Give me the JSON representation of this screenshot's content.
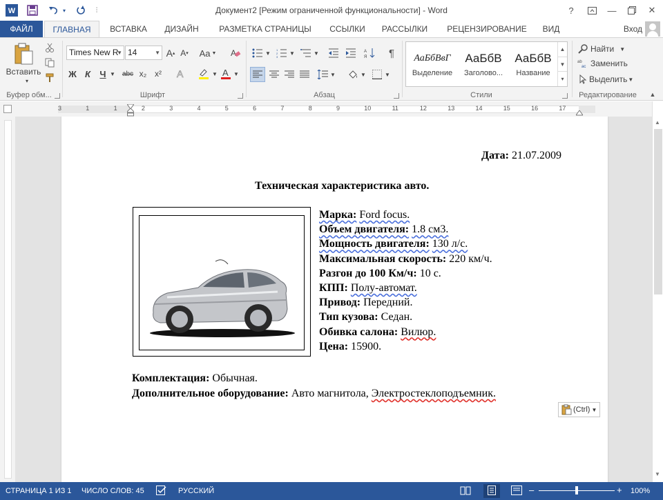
{
  "titlebar": {
    "title": "Документ2 [Режим ограниченной функциональности] - Word",
    "help": "?",
    "minimize": "—",
    "close": "✕"
  },
  "tabs": [
    "ФАЙЛ",
    "ГЛАВНАЯ",
    "ВСТАВКА",
    "ДИЗАЙН",
    "РАЗМЕТКА СТРАНИЦЫ",
    "ССЫЛКИ",
    "РАССЫЛКИ",
    "РЕЦЕНЗИРОВАНИЕ",
    "ВИД"
  ],
  "user": {
    "login_label": "Вход"
  },
  "ribbon": {
    "clipboard": {
      "paste_label": "Вставить",
      "group_label": "Буфер обм..."
    },
    "font": {
      "font_name": "Times New R",
      "font_size": "14",
      "group_label": "Шрифт",
      "bold": "Ж",
      "italic": "К",
      "underline": "Ч",
      "strike": "abc",
      "subscript": "x₂",
      "superscript": "x²",
      "case": "Aa"
    },
    "paragraph": {
      "group_label": "Абзац"
    },
    "styles": {
      "group_label": "Стили",
      "items": [
        {
          "sample": "АаБбВвГ",
          "name": "Выделение"
        },
        {
          "sample": "АаБбВ",
          "name": "Заголово..."
        },
        {
          "sample": "АаБбВ",
          "name": "Название"
        }
      ]
    },
    "editing": {
      "group_label": "Редактирование",
      "find": "Найти",
      "replace": "Заменить",
      "select": "Выделить"
    }
  },
  "ruler": {
    "labels": [
      "3",
      "1",
      "1",
      "2",
      "3",
      "4",
      "5",
      "6",
      "7",
      "8",
      "9",
      "10",
      "11",
      "12",
      "13",
      "14",
      "15",
      "16",
      "17"
    ]
  },
  "document": {
    "date_label": "Дата:",
    "date_value": "21.07.2009",
    "title": "Техническая характеристика авто.",
    "specs": [
      {
        "label": "Марка:",
        "value": "Ford focus."
      },
      {
        "label": "Объем двигателя:",
        "value": "1.8 см3."
      },
      {
        "label": "Мощность двигателя:",
        "value": "130 л/с."
      },
      {
        "label": "Максимальная скорость:",
        "value": "220 км/ч."
      },
      {
        "label": "Разгон до 100 Км/ч:",
        "value": "10 с."
      },
      {
        "label": "КПП:",
        "value": "Полу-автомат."
      },
      {
        "label": "Привод:",
        "value": "Передний."
      },
      {
        "label": "Тип кузова:",
        "value": "Седан."
      },
      {
        "label": "Обивка салона:",
        "value": "Вилюр."
      },
      {
        "label": "Цена:",
        "value": "15900."
      }
    ],
    "equipment_label": "Комплектация:",
    "equipment_value": "Обычная.",
    "extra_label": "Дополнительное оборудование:",
    "extra_value_1": "Авто магнитола,",
    "extra_value_2": "Электростеклоподъемник.",
    "paste_options": "(Ctrl)"
  },
  "statusbar": {
    "page": "СТРАНИЦА 1 ИЗ 1",
    "words": "ЧИСЛО СЛОВ: 45",
    "language": "РУССКИЙ",
    "zoom": "100%",
    "minus": "–",
    "plus": "+"
  },
  "colors": {
    "accent": "#2b579a"
  }
}
